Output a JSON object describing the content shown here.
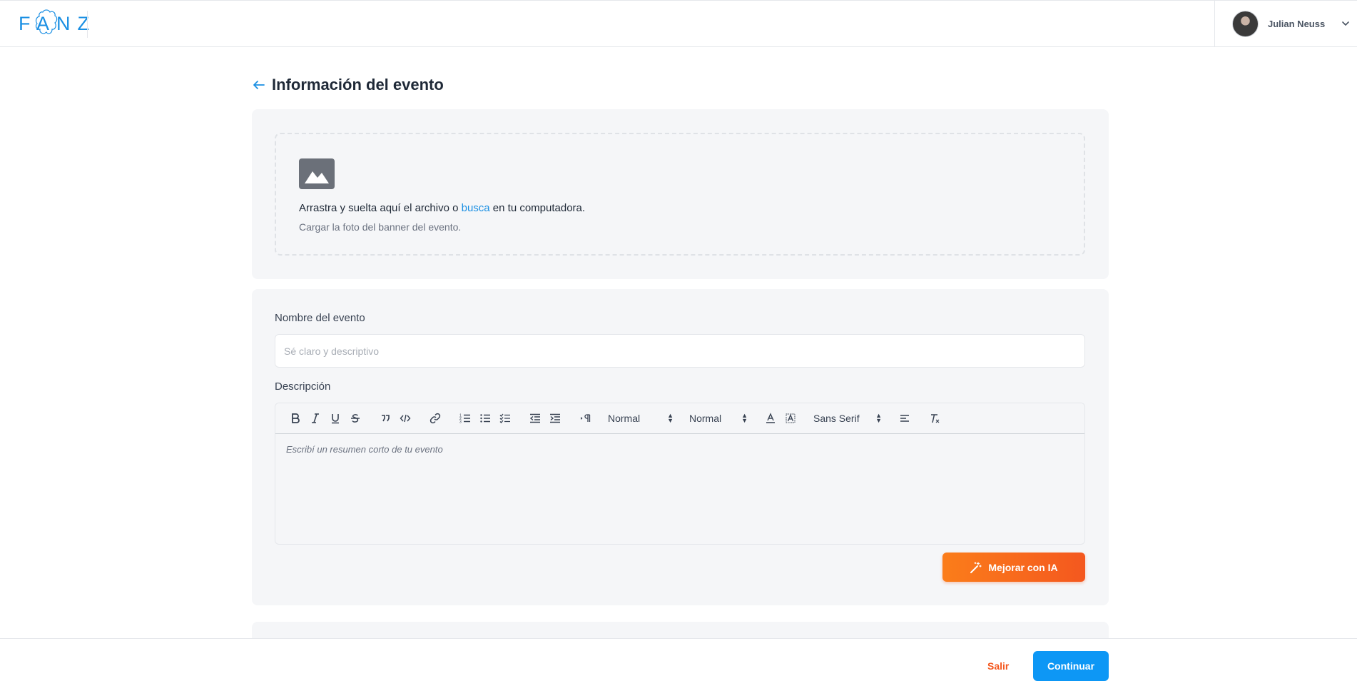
{
  "header": {
    "logo_text": "FANZ",
    "user_name": "Julian Neuss"
  },
  "page": {
    "title": "Información del evento"
  },
  "upload": {
    "text_before": "Arrastra y suelta aquí el archivo o ",
    "link": "busca",
    "text_after": " en tu computadora.",
    "hint": "Cargar la foto del banner del evento."
  },
  "form": {
    "name_label": "Nombre del evento",
    "name_placeholder": "Sé claro y descriptivo",
    "name_value": "",
    "description_label": "Descripción",
    "description_placeholder": "Escribí un resumen corto de tu evento",
    "toolbar": {
      "header_select": "Normal",
      "size_select": "Normal",
      "font_select": "Sans Serif"
    },
    "ai_button": "Mejorar con IA"
  },
  "footer": {
    "exit_label": "Salir",
    "continue_label": "Continuar"
  },
  "colors": {
    "brand_blue": "#0d97f5",
    "accent_orange": "#f4581f",
    "card_bg": "#f5f6f8"
  },
  "icons": [
    "fanz-logo-icon",
    "user-avatar",
    "chevron-down-icon",
    "arrow-left-icon",
    "image-icon",
    "magic-wand-icon"
  ]
}
